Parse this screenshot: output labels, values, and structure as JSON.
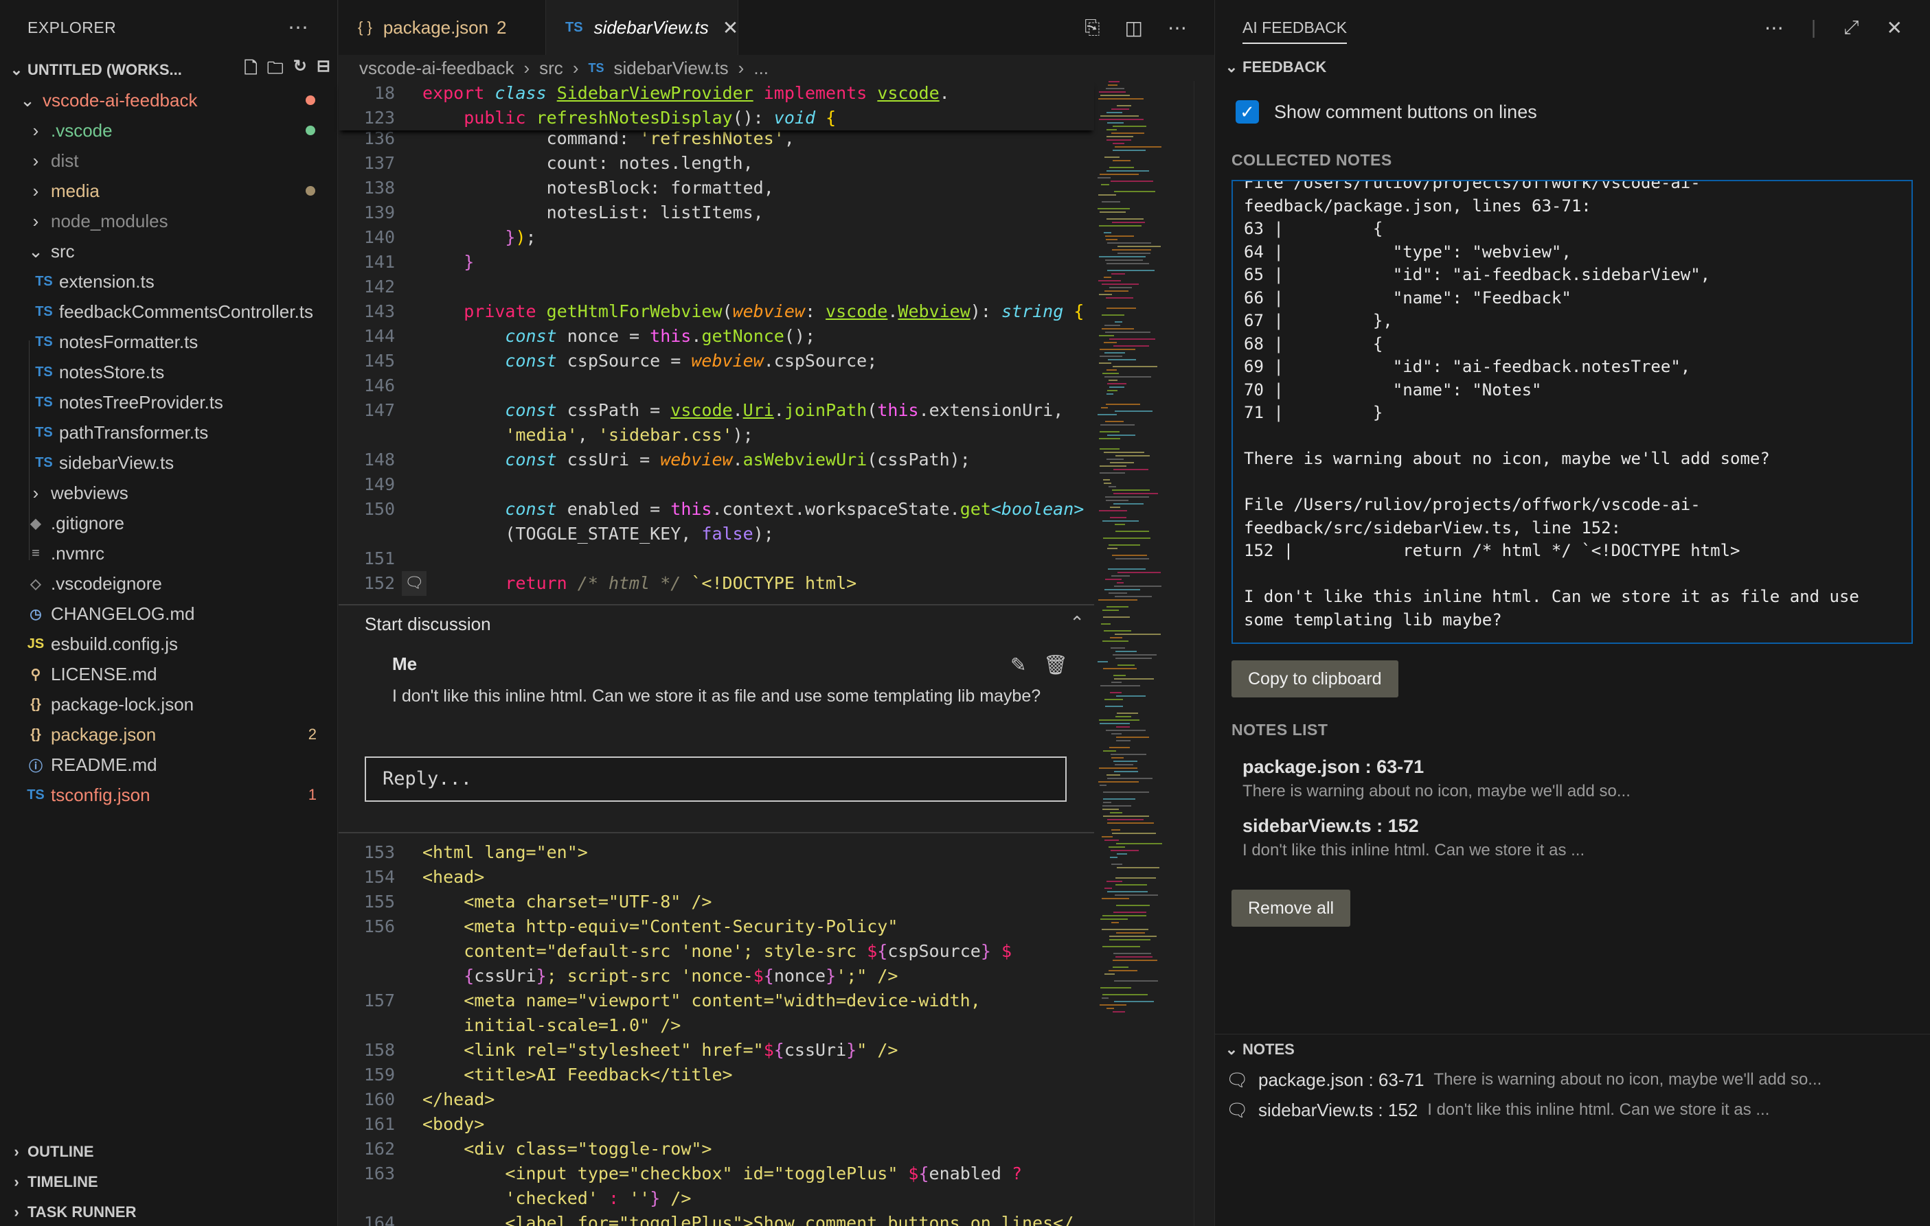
{
  "explorer": {
    "title": "EXPLORER",
    "workspace": "UNTITLED (WORKS...",
    "items": [
      {
        "label": "vscode-ai-feedback",
        "kind": "folder-open",
        "color": "#f48771",
        "dot": "#f48771",
        "indent": 0
      },
      {
        "label": ".vscode",
        "kind": "folder",
        "color": "#73c991",
        "dot": "#73c991",
        "indent": 1
      },
      {
        "label": "dist",
        "kind": "folder",
        "color": "#8c8c8c",
        "indent": 1
      },
      {
        "label": "media",
        "kind": "folder",
        "color": "#e2c08d",
        "dot": "#a08d6a",
        "indent": 1
      },
      {
        "label": "node_modules",
        "kind": "folder",
        "color": "#8c8c8c",
        "indent": 1
      },
      {
        "label": "src",
        "kind": "folder-open",
        "color": "#cccccc",
        "indent": 1
      },
      {
        "label": "extension.ts",
        "kind": "ts",
        "color": "#cccccc",
        "indent": 2
      },
      {
        "label": "feedbackCommentsController.ts",
        "kind": "ts",
        "color": "#cccccc",
        "indent": 2
      },
      {
        "label": "notesFormatter.ts",
        "kind": "ts",
        "color": "#cccccc",
        "indent": 2
      },
      {
        "label": "notesStore.ts",
        "kind": "ts",
        "color": "#cccccc",
        "indent": 2
      },
      {
        "label": "notesTreeProvider.ts",
        "kind": "ts",
        "color": "#cccccc",
        "indent": 2
      },
      {
        "label": "pathTransformer.ts",
        "kind": "ts",
        "color": "#cccccc",
        "indent": 2
      },
      {
        "label": "sidebarView.ts",
        "kind": "ts",
        "color": "#cccccc",
        "indent": 2
      },
      {
        "label": "webviews",
        "kind": "folder",
        "color": "#cccccc",
        "indent": 1
      },
      {
        "label": ".gitignore",
        "kind": "git",
        "color": "#cccccc",
        "indent": 1
      },
      {
        "label": ".nvmrc",
        "kind": "lines",
        "color": "#cccccc",
        "indent": 1
      },
      {
        "label": ".vscodeignore",
        "kind": "vsc",
        "color": "#cccccc",
        "indent": 1
      },
      {
        "label": "CHANGELOG.md",
        "kind": "clock",
        "color": "#cccccc",
        "indent": 1
      },
      {
        "label": "esbuild.config.js",
        "kind": "js",
        "color": "#cccccc",
        "indent": 1
      },
      {
        "label": "LICENSE.md",
        "kind": "license",
        "color": "#cccccc",
        "indent": 1
      },
      {
        "label": "package-lock.json",
        "kind": "json",
        "color": "#cccccc",
        "indent": 1
      },
      {
        "label": "package.json",
        "kind": "json",
        "color": "#e2c08d",
        "badge": "2",
        "indent": 1
      },
      {
        "label": "README.md",
        "kind": "info",
        "color": "#cccccc",
        "indent": 1
      },
      {
        "label": "tsconfig.json",
        "kind": "tsconfig",
        "color": "#f48771",
        "badge": "1",
        "indent": 1
      }
    ],
    "outline": "OUTLINE",
    "timeline": "TIMELINE",
    "task_runner": "TASK RUNNER"
  },
  "tabs": [
    {
      "label": "package.json",
      "badge": "2",
      "icon": "{ }"
    },
    {
      "label": "sidebarView.ts",
      "icon": "TS"
    }
  ],
  "breadcrumb": [
    "vscode-ai-feedback",
    "src",
    "sidebarView.ts",
    "..."
  ],
  "code_top": [
    {
      "ln": "136",
      "html": "            command: <span class='st'>'refreshNotes'</span>,"
    },
    {
      "ln": "137",
      "html": "            count: notes.length,"
    },
    {
      "ln": "138",
      "html": "            notesBlock: formatted,"
    },
    {
      "ln": "139",
      "html": "            notesList: listItems,"
    },
    {
      "ln": "140",
      "html": "        <span class='br2'>}</span><span class='br'>)</span>;"
    },
    {
      "ln": "141",
      "html": "    <span class='br2'>}</span>"
    },
    {
      "ln": "142",
      "html": ""
    },
    {
      "ln": "143",
      "html": "    <span class='kw'>private</span> <span class='fn'>getHtmlForWebview</span>(<span class='it'>webview</span>: <span class='vc'>vscode</span>.<span class='vc'>Webview</span>): <span class='ty'>string</span> <span class='br'>{</span>"
    },
    {
      "ln": "144",
      "html": "        <span class='ty'>const</span> nonce = <span class='this'>this</span>.<span class='fn'>getNonce</span>();"
    },
    {
      "ln": "145",
      "html": "        <span class='ty'>const</span> cspSource = <span class='it'>webview</span>.cspSource;"
    },
    {
      "ln": "146",
      "html": ""
    },
    {
      "ln": "147",
      "html": "        <span class='ty'>const</span> cssPath = <span class='vc'>vscode</span>.<span class='vc'>Uri</span>.<span class='fn'>joinPath</span>(<span class='this'>this</span>.extensionUri,"
    },
    {
      "ln": "",
      "html": "        <span class='st'>'media'</span>, <span class='st'>'sidebar.css'</span>);"
    },
    {
      "ln": "148",
      "html": "        <span class='ty'>const</span> cssUri = <span class='it'>webview</span>.<span class='fn'>asWebviewUri</span>(cssPath);"
    },
    {
      "ln": "149",
      "html": ""
    },
    {
      "ln": "150",
      "html": "        <span class='ty'>const</span> enabled = <span class='this'>this</span>.context.workspaceState.<span class='fn'>get</span><span class='ty'>&lt;boolean&gt;</span>"
    },
    {
      "ln": "",
      "html": "        (TOGGLE_STATE_KEY, <span class='fl'>false</span>);"
    },
    {
      "ln": "151",
      "html": ""
    },
    {
      "ln": "152",
      "html": "        <span class='kw'>return</span> <span class='cm'>/* html */</span> <span class='st'>`&lt;!DOCTYPE html&gt;</span>"
    }
  ],
  "sticky": [
    {
      "ln": "18",
      "html": "<span class='kw'>export</span> <span class='ty'>class</span> <span class='cls'>SidebarViewProvider</span> <span class='kw'>implements</span> <span class='vc'>vscode</span>."
    },
    {
      "ln": "123",
      "html": "    <span class='kw'>public</span> <span class='fn'>refreshNotesDisplay</span>(): <span class='ty'>void</span> <span class='br'>{</span>"
    }
  ],
  "code_bottom": [
    {
      "ln": "153",
      "html": "<span class='st'>&lt;html lang=\"en\"&gt;</span>"
    },
    {
      "ln": "154",
      "html": "<span class='st'>&lt;head&gt;</span>"
    },
    {
      "ln": "155",
      "html": "    <span class='st'>&lt;meta charset=\"UTF-8\" /&gt;</span>"
    },
    {
      "ln": "156",
      "html": "    <span class='st'>&lt;meta http-equiv=\"Content-Security-Policy\"</span>"
    },
    {
      "ln": "",
      "html": "    <span class='st'>content=\"default-src 'none'; style-src </span><span class='kw'>$</span><span class='br2'>{</span>cspSource<span class='br2'>}</span><span class='st'> </span><span class='kw'>$</span>"
    },
    {
      "ln": "",
      "html": "    <span class='br2'>{</span>cssUri<span class='br2'>}</span><span class='st'>; script-src 'nonce-</span><span class='kw'>$</span><span class='br2'>{</span>nonce<span class='br2'>}</span><span class='st'>';\" /&gt;</span>"
    },
    {
      "ln": "157",
      "html": "    <span class='st'>&lt;meta name=\"viewport\" content=\"width=device-width,</span>"
    },
    {
      "ln": "",
      "html": "    <span class='st'>initial-scale=1.0\" /&gt;</span>"
    },
    {
      "ln": "158",
      "html": "    <span class='st'>&lt;link rel=\"stylesheet\" href=\"</span><span class='kw'>$</span><span class='br2'>{</span>cssUri<span class='br2'>}</span><span class='st'>\" /&gt;</span>"
    },
    {
      "ln": "159",
      "html": "    <span class='st'>&lt;title&gt;AI Feedback&lt;/title&gt;</span>"
    },
    {
      "ln": "160",
      "html": "<span class='st'>&lt;/head&gt;</span>"
    },
    {
      "ln": "161",
      "html": "<span class='st'>&lt;body&gt;</span>"
    },
    {
      "ln": "162",
      "html": "    <span class='st'>&lt;div class=\"toggle-row\"&gt;</span>"
    },
    {
      "ln": "163",
      "html": "        <span class='st'>&lt;input type=\"checkbox\" id=\"togglePlus\" </span><span class='kw'>$</span><span class='br2'>{</span>enabled <span class='kw'>?</span>"
    },
    {
      "ln": "",
      "html": "        <span class='st'>'checked'</span> <span class='kw'>:</span> <span class='st'>''</span><span class='br2'>}</span><span class='st'> /&gt;</span>"
    },
    {
      "ln": "164",
      "html": "        <span class='st'>&lt;label for=\"togglePlus\"&gt;Show comment buttons on lines&lt;/</span>"
    }
  ],
  "discussion": {
    "title": "Start discussion",
    "author": "Me",
    "body": "I don't like this inline html. Can we store it as file and use some templating lib maybe?",
    "reply_placeholder": "Reply..."
  },
  "panel": {
    "title": "AI FEEDBACK",
    "feedback_section": "FEEDBACK",
    "toggle_label": "Show comment buttons on lines",
    "collected_label": "COLLECTED NOTES",
    "collected_text": "File /Users/ruliov/projects/offwork/vscode-ai-feedback/package.json, lines 63-71:\n63 |         {\n64 |           \"type\": \"webview\",\n65 |           \"id\": \"ai-feedback.sidebarView\",\n66 |           \"name\": \"Feedback\"\n67 |         },\n68 |         {\n69 |           \"id\": \"ai-feedback.notesTree\",\n70 |           \"name\": \"Notes\"\n71 |         }\n\nThere is warning about no icon, maybe we'll add some?\n\nFile /Users/ruliov/projects/offwork/vscode-ai-feedback/src/sidebarView.ts, line 152:\n152 |           return /* html */ `<!DOCTYPE html>\n\nI don't like this inline html. Can we store it as file and use some templating lib maybe?",
    "copy_button": "Copy to clipboard",
    "notes_list_label": "NOTES LIST",
    "notes": [
      {
        "title": "package.json : 63-71",
        "desc": "There is warning about no icon, maybe we'll add so..."
      },
      {
        "title": "sidebarView.ts : 152",
        "desc": "I don't like this inline html. Can we store it as ..."
      }
    ],
    "remove_button": "Remove all",
    "notes_section": "NOTES",
    "tree_notes": [
      {
        "title": "package.json : 63-71",
        "desc": "There is warning about no icon, maybe we'll add so..."
      },
      {
        "title": "sidebarView.ts : 152",
        "desc": "I don't like this inline html. Can we store it as ..."
      }
    ]
  }
}
